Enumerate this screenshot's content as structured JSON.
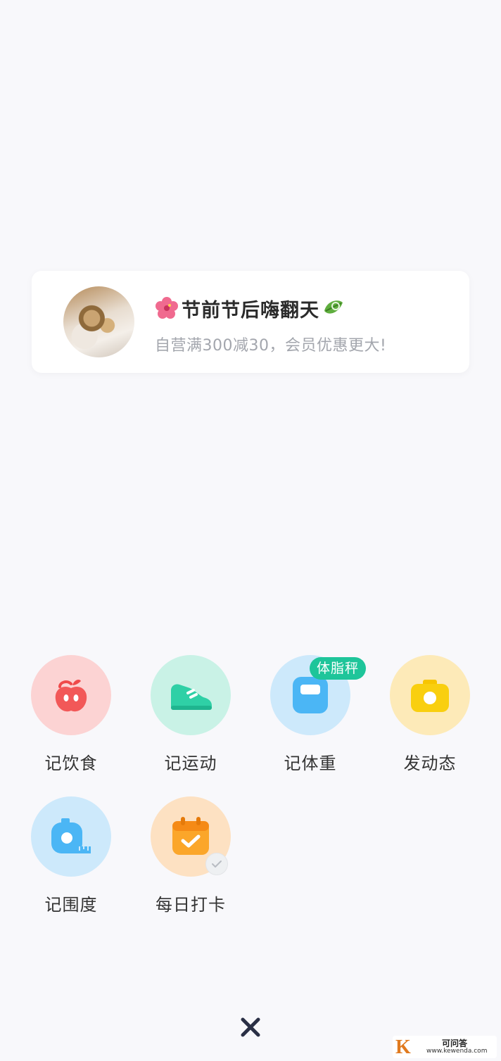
{
  "promo": {
    "title": "节前节后嗨翻天",
    "subtitle": "自营满300减30，会员优惠更大!"
  },
  "actions": [
    {
      "label": "记饮食",
      "icon": "apple-icon",
      "bg": "#fcd3d3"
    },
    {
      "label": "记运动",
      "icon": "sneaker-icon",
      "bg": "#c9f2e6"
    },
    {
      "label": "记体重",
      "icon": "scale-icon",
      "bg": "#cde9fb",
      "badge": "体脂秤"
    },
    {
      "label": "发动态",
      "icon": "camera-icon",
      "bg": "#fdeab8"
    },
    {
      "label": "记围度",
      "icon": "tape-measure-icon",
      "bg": "#cde9fb"
    },
    {
      "label": "每日打卡",
      "icon": "calendar-check-icon",
      "bg": "#fde1c2"
    }
  ],
  "close": {
    "icon": "close-icon"
  },
  "watermark": {
    "letter": "K",
    "cn": "可问答",
    "url": "www.kewenda.com"
  }
}
